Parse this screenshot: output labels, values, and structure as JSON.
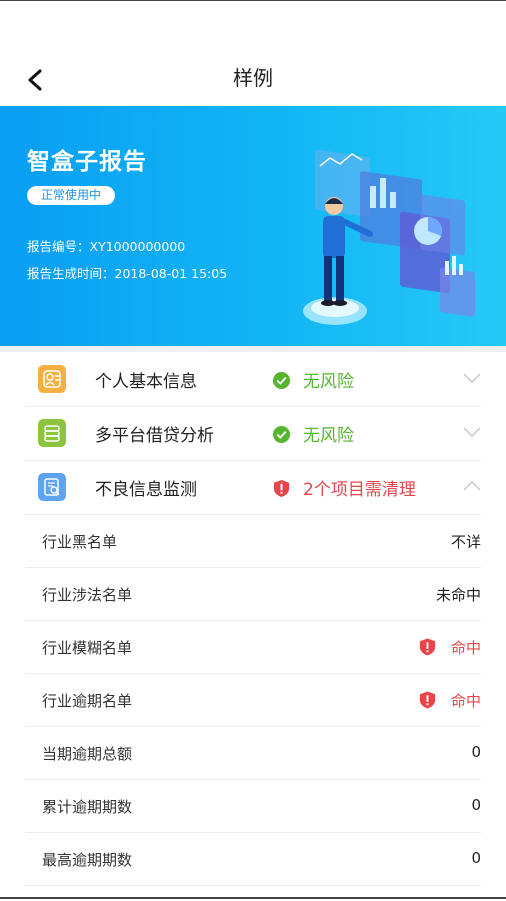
{
  "nav": {
    "title": "样例"
  },
  "hero": {
    "title": "智盒子报告",
    "badge": "正常使用中",
    "report_no": "报告编号：XY1000000000",
    "report_time": "报告生成时间：2018-08-01 15:05"
  },
  "risk_items": [
    {
      "label": "个人基本信息",
      "status": "无风险",
      "level": "ok",
      "icon": "person-card-icon",
      "icon_color": "#f6b042",
      "expanded": false
    },
    {
      "label": "多平台借贷分析",
      "status": "无风险",
      "level": "ok",
      "icon": "database-icon",
      "icon_color": "#8cc43f",
      "expanded": false
    },
    {
      "label": "不良信息监测",
      "status": "2个项目需清理",
      "level": "bad",
      "icon": "document-search-icon",
      "icon_color": "#5ea3f0",
      "expanded": true
    }
  ],
  "details": [
    {
      "label": "行业黑名单",
      "value": "不详",
      "hit": false
    },
    {
      "label": "行业涉法名单",
      "value": "未命中",
      "hit": false
    },
    {
      "label": "行业模糊名单",
      "value": "命中",
      "hit": true
    },
    {
      "label": "行业逾期名单",
      "value": "命中",
      "hit": true
    },
    {
      "label": "当期逾期总额",
      "value": "0",
      "hit": false
    },
    {
      "label": "累计逾期期数",
      "value": "0",
      "hit": false
    },
    {
      "label": "最高逾期期数",
      "value": "0",
      "hit": false
    }
  ],
  "colors": {
    "hero_start": "#0a9ef3",
    "hero_end": "#26c9f6",
    "ok": "#55b52e",
    "bad": "#e8454b"
  }
}
